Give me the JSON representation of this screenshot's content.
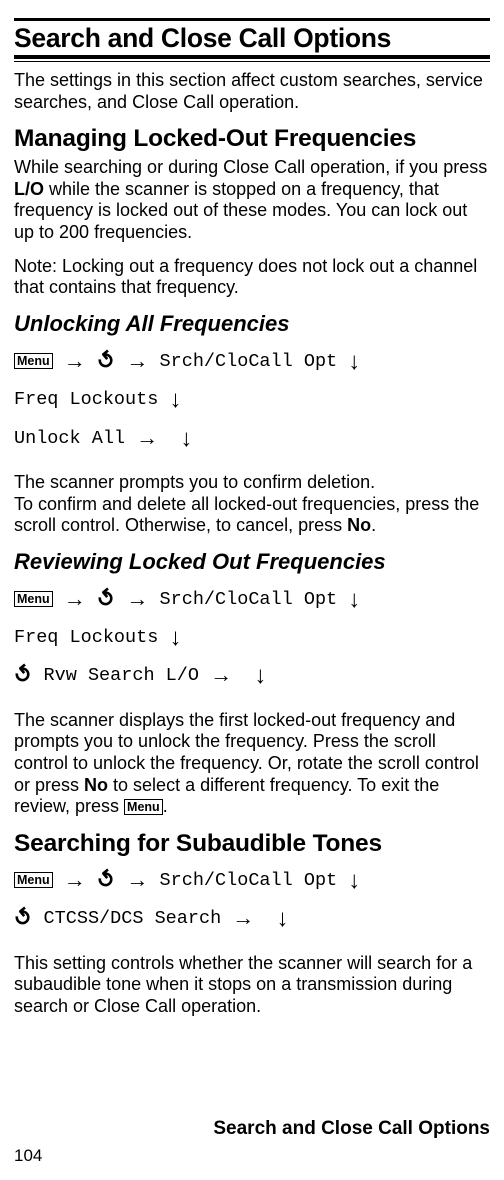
{
  "page_title": "Search and Close Call Options",
  "intro": "The settings in this section affect custom searches, service searches, and Close Call operation.",
  "h2_managing": "Managing Locked-Out Frequencies",
  "managing_p1": "While searching or during Close Call operation, if you press ",
  "managing_p1_bold": "L/O",
  "managing_p1_cont": " while the scanner is stopped on a frequency, that frequency is locked out of these modes. You can lock out up to 200 frequencies.",
  "managing_note": "Note: Locking out a frequency does not lock out a channel that contains that frequency.",
  "h3_unlock": "Unlocking All Frequencies",
  "menu_label": "Menu",
  "srch_opt": "Srch/CloCall Opt",
  "freq_lockouts": "Freq Lockouts",
  "unlock_all": "Unlock All",
  "unlock_p": "The scanner prompts you to confirm deletion. To confirm and delete all locked-out frequencies, press the scroll control. Otherwise, to cancel, press ",
  "unlock_p_bold": "No",
  "unlock_p_end": ".",
  "h3_review": "Reviewing Locked Out Frequencies",
  "rvw_search": "Rvw Search L/O",
  "review_p1": "The scanner displays the first locked-out frequency and prompts you to unlock the frequency. Press the scroll control to unlock the frequency. Or, rotate the scroll control or press ",
  "review_p1_bold": "No",
  "review_p1_cont": " to select a different frequency. To exit the review, press ",
  "review_p1_end": ".",
  "h2_searching": "Searching for Subaudible Tones",
  "ctcss": "CTCSS/DCS Search",
  "searching_p": "This setting controls whether the scanner will search for a subaudible tone when it stops on a transmission during search or Close Call operation.",
  "footer_title": "Search and Close Call Options",
  "page_number": "104"
}
